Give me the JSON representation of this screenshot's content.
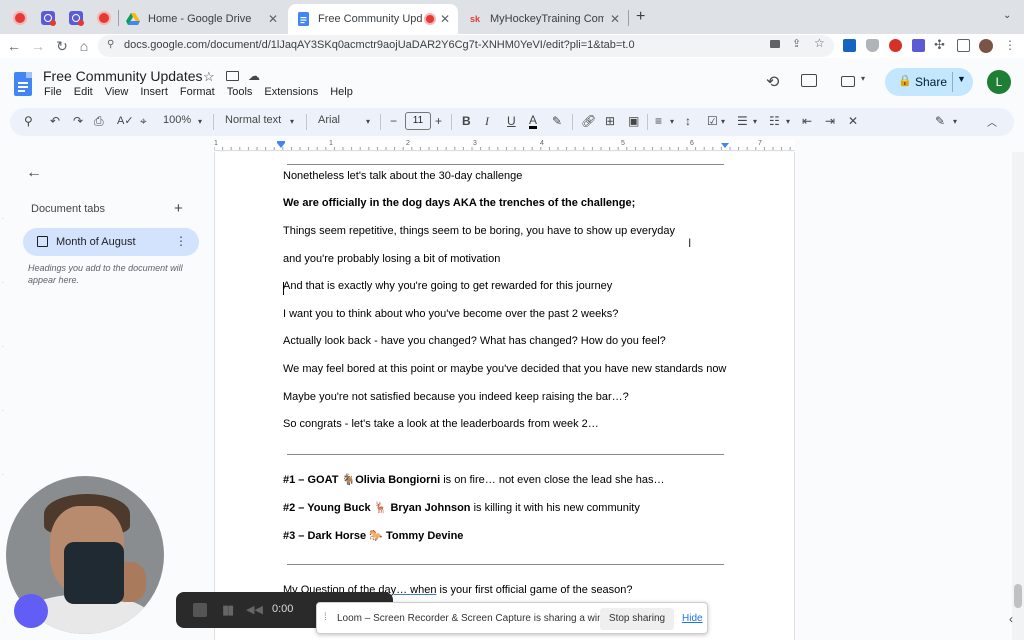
{
  "browser": {
    "tabs": [
      {
        "title": "Home - Google Drive"
      },
      {
        "title": "Free Community Updates"
      },
      {
        "title": "MyHockeyTraining Community"
      }
    ],
    "new_tab": "+",
    "url": "docs.google.com/document/d/1lJaqAY3SKq0acmctr9aojUaDAR2Y6Cg7t-XNHM0YeVI/edit?pli=1&tab=t.0",
    "hockey_favicon_text": "sk"
  },
  "docs": {
    "title": "Free Community Updates",
    "menu": [
      "File",
      "Edit",
      "View",
      "Insert",
      "Format",
      "Tools",
      "Extensions",
      "Help"
    ],
    "share_label": "Share",
    "avatar_letter": "L"
  },
  "toolbar": {
    "zoom": "100%",
    "style": "Normal text",
    "font": "Arial",
    "font_size": "11"
  },
  "ruler": {
    "numbers": [
      "1",
      "1",
      "2",
      "3",
      "4",
      "5",
      "6",
      "7"
    ]
  },
  "sidebar": {
    "heading": "Document tabs",
    "tab_label": "Month of August",
    "note": "Headings you add to the document will appear here."
  },
  "document": {
    "p1": "Nonetheless let's talk about the 30-day challenge",
    "p2": "We are officially in the dog days AKA the trenches of the challenge;",
    "p3": "Things seem repetitive, things seem to be boring, you have to show up everyday",
    "p4": "and you're probably losing a bit of motivation",
    "p5": "And that is exactly why you're going to get rewarded for this journey",
    "p6": "I want you to think about who you've become over the past 2 weeks?",
    "p7": "Actually look back - have you changed? What has changed? How do you feel?",
    "p8": "We may feel bored at this point or maybe you've decided that you have new standards now",
    "p9": "Maybe you're not satisfied because you indeed keep raising the bar…?",
    "p10": "So congrats - let's take a look at the leaderboards from week 2…",
    "lb1": {
      "rank": "#1 – GOAT 🐐",
      "name": "Olivia Bongiorni",
      "rest": " is on fire… not even close the lead she has…"
    },
    "lb2": {
      "rank": "#2 – Young Buck 🦌 ",
      "name": "Bryan Johnson",
      "rest": " is killing it with his new community"
    },
    "lb3": {
      "rank": "#3 – Dark Horse 🐎 ",
      "name": "Tommy Devine",
      "rest": ""
    },
    "q_pre": "My Question of the day… ",
    "q_link": "when",
    "q_post": " is your first official game of the season?"
  },
  "loom": {
    "time": "0:00",
    "share_message": "Loom – Screen Recorder & Screen Capture is sharing a window.",
    "stop_sharing": "Stop sharing",
    "hide": "Hide"
  },
  "colors": {
    "accent": "#1a73e8",
    "share_btn": "#c2e7ff",
    "active_tab": "#d3e3fd",
    "recording": "#e53935",
    "avatar": "#1e7e34"
  }
}
